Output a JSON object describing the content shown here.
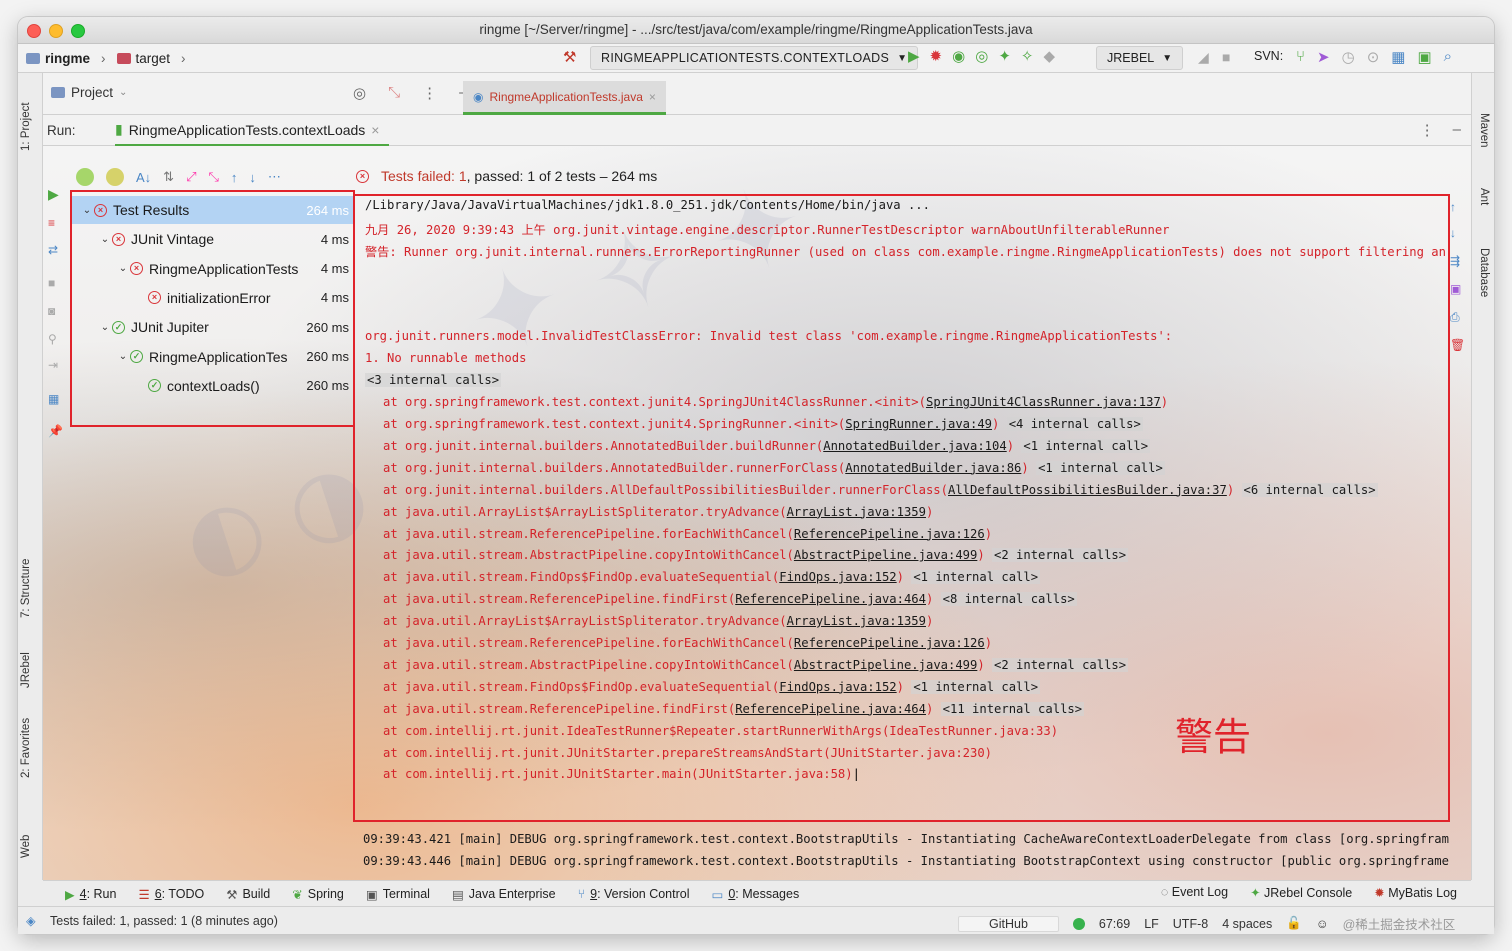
{
  "window": {
    "title": "ringme [~/Server/ringme] - .../src/test/java/com/example/ringme/RingmeApplicationTests.java"
  },
  "navbar": {
    "project": "ringme",
    "folder": "target",
    "run_config": "RINGMEAPPLICATIONTESTS.CONTEXTLOADS",
    "jrebel": "JREBEL",
    "svn": "SVN:"
  },
  "left_tabs": [
    "1: Project",
    "7: Structure",
    "JRebel",
    "2: Favorites",
    "Web"
  ],
  "right_tabs": [
    "Maven",
    "Ant",
    "Database"
  ],
  "project_pane": {
    "label": "Project"
  },
  "editor_tab": {
    "label": "RingmeApplicationTests.java"
  },
  "run": {
    "label": "Run:",
    "tab": "RingmeApplicationTests.contextLoads"
  },
  "test_status": {
    "prefix": "Tests failed:",
    "failed_count": "1",
    "rest": ", passed: 1 of 2 tests – 264 ms"
  },
  "tree": [
    {
      "label": "Test Results",
      "time": "264 ms",
      "status": "fail",
      "depth": 0,
      "expanded": true,
      "selected": true
    },
    {
      "label": "JUnit Vintage",
      "time": "4 ms",
      "status": "fail",
      "depth": 1,
      "expanded": true
    },
    {
      "label": "RingmeApplicationTests",
      "time": "4 ms",
      "status": "fail",
      "depth": 2,
      "expanded": true
    },
    {
      "label": "initializationError",
      "time": "4 ms",
      "status": "fail",
      "depth": 3
    },
    {
      "label": "JUnit Jupiter",
      "time": "260 ms",
      "status": "pass",
      "depth": 1,
      "expanded": true
    },
    {
      "label": "RingmeApplicationTes",
      "time": "260 ms",
      "status": "pass",
      "depth": 2,
      "expanded": true
    },
    {
      "label": "contextLoads()",
      "time": "260 ms",
      "status": "pass",
      "depth": 3
    }
  ],
  "console": {
    "header": [
      {
        "text": "/Library/Java/JavaVirtualMachines/jdk1.8.0_251.jdk/Contents/Home/bin/java ...",
        "color": "dark"
      },
      {
        "text": "九月 26, 2020 9:39:43 上午 org.junit.vintage.engine.descriptor.RunnerTestDescriptor warnAboutUnfilterableRunner",
        "color": "red"
      },
      {
        "text": "警告: Runner org.junit.internal.runners.ErrorReportingRunner (used on class com.example.ringme.RingmeApplicationTests) does not support filtering an",
        "color": "red"
      }
    ],
    "error": "org.junit.runners.model.InvalidTestClassError: Invalid test class 'com.example.ringme.RingmeApplicationTests':",
    "error_detail": "  1. No runnable methods",
    "internal_first": "<3 internal calls>",
    "stack": [
      {
        "pre": "at org.springframework.test.context.junit4.SpringJUnit4ClassRunner.<init>(",
        "link": "SpringJUnit4ClassRunner.java:137",
        "post": ")",
        "extra": ""
      },
      {
        "pre": "at org.springframework.test.context.junit4.SpringRunner.<init>(",
        "link": "SpringRunner.java:49",
        "post": ")",
        "extra": "<4 internal calls>"
      },
      {
        "pre": "at org.junit.internal.builders.AnnotatedBuilder.buildRunner(",
        "link": "AnnotatedBuilder.java:104",
        "post": ")",
        "extra": "<1 internal call>"
      },
      {
        "pre": "at org.junit.internal.builders.AnnotatedBuilder.runnerForClass(",
        "link": "AnnotatedBuilder.java:86",
        "post": ")",
        "extra": "<1 internal call>"
      },
      {
        "pre": "at org.junit.internal.builders.AllDefaultPossibilitiesBuilder.runnerForClass(",
        "link": "AllDefaultPossibilitiesBuilder.java:37",
        "post": ")",
        "extra": "<6 internal calls>"
      },
      {
        "pre": "at java.util.ArrayList$ArrayListSpliterator.tryAdvance(",
        "link": "ArrayList.java:1359",
        "post": ")",
        "extra": ""
      },
      {
        "pre": "at java.util.stream.ReferencePipeline.forEachWithCancel(",
        "link": "ReferencePipeline.java:126",
        "post": ")",
        "extra": ""
      },
      {
        "pre": "at java.util.stream.AbstractPipeline.copyIntoWithCancel(",
        "link": "AbstractPipeline.java:499",
        "post": ")",
        "extra": "<2 internal calls>"
      },
      {
        "pre": "at java.util.stream.FindOps$FindOp.evaluateSequential(",
        "link": "FindOps.java:152",
        "post": ")",
        "extra": "<1 internal call>"
      },
      {
        "pre": "at java.util.stream.ReferencePipeline.findFirst(",
        "link": "ReferencePipeline.java:464",
        "post": ")",
        "extra": "<8 internal calls>"
      },
      {
        "pre": "at java.util.ArrayList$ArrayListSpliterator.tryAdvance(",
        "link": "ArrayList.java:1359",
        "post": ")",
        "extra": ""
      },
      {
        "pre": "at java.util.stream.ReferencePipeline.forEachWithCancel(",
        "link": "ReferencePipeline.java:126",
        "post": ")",
        "extra": ""
      },
      {
        "pre": "at java.util.stream.AbstractPipeline.copyIntoWithCancel(",
        "link": "AbstractPipeline.java:499",
        "post": ")",
        "extra": "<2 internal calls>"
      },
      {
        "pre": "at java.util.stream.FindOps$FindOp.evaluateSequential(",
        "link": "FindOps.java:152",
        "post": ")",
        "extra": "<1 internal call>"
      },
      {
        "pre": "at java.util.stream.ReferencePipeline.findFirst(",
        "link": "ReferencePipeline.java:464",
        "post": ")",
        "extra": "<11 internal calls>"
      },
      {
        "pre": "at com.intellij.rt.junit.IdeaTestRunner$Repeater.startRunnerWithArgs(IdeaTestRunner.java:33)",
        "link": "",
        "post": "",
        "extra": ""
      },
      {
        "pre": "at com.intellij.rt.junit.JUnitStarter.prepareStreamsAndStart(JUnitStarter.java:230)",
        "link": "",
        "post": "",
        "extra": ""
      },
      {
        "pre": "at com.intellij.rt.junit.JUnitStarter.main(JUnitStarter.java:58)",
        "link": "",
        "post": "",
        "extra": ""
      }
    ],
    "annotation": "警告",
    "debug": [
      "09:39:43.421 [main] DEBUG org.springframework.test.context.BootstrapUtils - Instantiating CacheAwareContextLoaderDelegate from class [org.springfram",
      "09:39:43.446 [main] DEBUG org.springframework.test.context.BootstrapUtils - Instantiating BootstrapContext using constructor [public org.springframe"
    ]
  },
  "bottom_tools": [
    {
      "key": "4",
      "rest": ": Run",
      "icon": "play-icon"
    },
    {
      "key": "6",
      "rest": ": TODO",
      "icon": "todo-icon"
    },
    {
      "key": "",
      "rest": "Build",
      "icon": "build-icon"
    },
    {
      "key": "",
      "rest": "Spring",
      "icon": "spring-icon"
    },
    {
      "key": "",
      "rest": "Terminal",
      "icon": "terminal-icon"
    },
    {
      "key": "",
      "rest": "Java Enterprise",
      "icon": "java-enterprise-icon"
    },
    {
      "key": "9",
      "rest": ": Version Control",
      "icon": "vcs-icon"
    },
    {
      "key": "0",
      "rest": ": Messages",
      "icon": "messages-icon"
    }
  ],
  "bottom_tools_right": [
    "Event Log",
    "JRebel Console",
    "MyBatis Log"
  ],
  "statusbar": {
    "message": "Tests failed: 1, passed: 1 (8 minutes ago)",
    "github": "GitHub",
    "position": "67:69",
    "line_sep": "LF",
    "encoding": "UTF-8",
    "indent": "4 spaces",
    "watermark": "@稀土掘金技术社区"
  },
  "colors": {
    "accent_green": "#4ea843",
    "error_red": "#d4232a",
    "highlight_box": "#e0232b",
    "selection": "#b3d3f3"
  }
}
